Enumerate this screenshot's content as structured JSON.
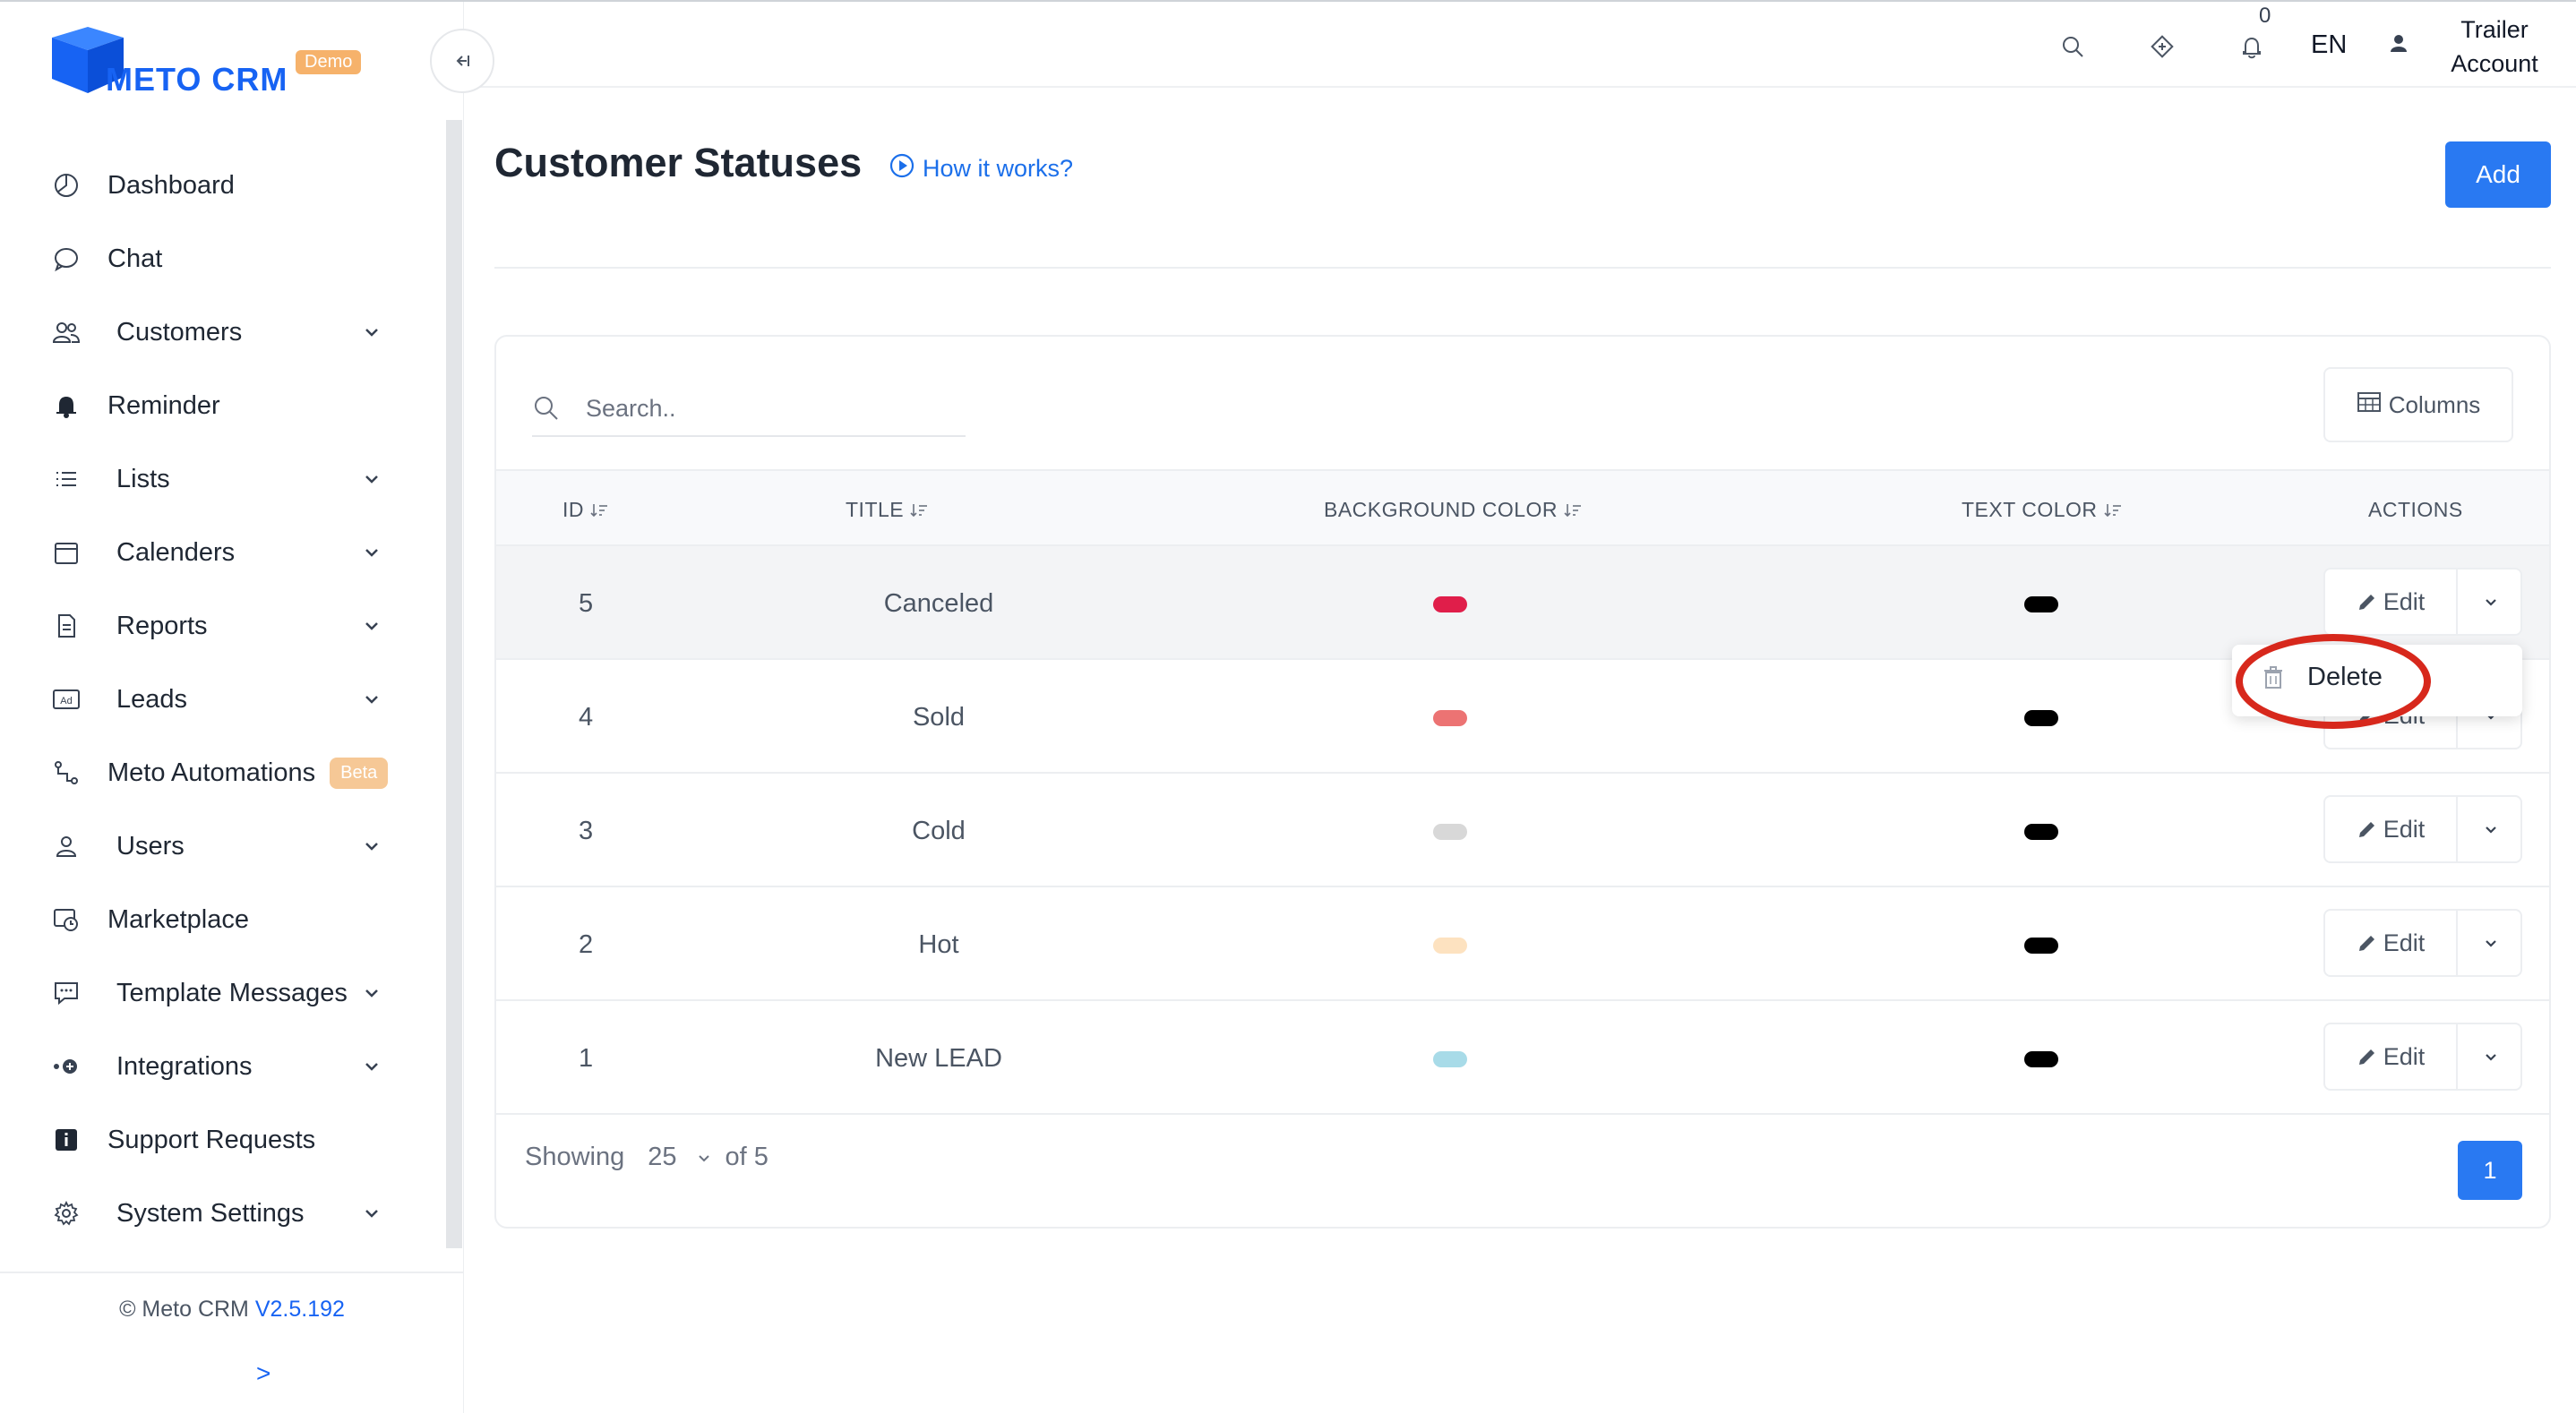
{
  "app": {
    "brand_name": "METO CRM",
    "brand_badge": "Demo"
  },
  "sidebar": {
    "items": [
      {
        "label": "Dashboard",
        "icon": "dashboard-icon",
        "has_chevron": false
      },
      {
        "label": "Chat",
        "icon": "chat-icon",
        "has_chevron": false
      },
      {
        "label": "Customers",
        "icon": "customers-icon",
        "has_chevron": true
      },
      {
        "label": "Reminder",
        "icon": "bell-icon",
        "has_chevron": false
      },
      {
        "label": "Lists",
        "icon": "list-icon",
        "has_chevron": true
      },
      {
        "label": "Calenders",
        "icon": "calendar-icon",
        "has_chevron": true
      },
      {
        "label": "Reports",
        "icon": "report-icon",
        "has_chevron": true
      },
      {
        "label": "Leads",
        "icon": "ad-icon",
        "has_chevron": true
      },
      {
        "label": "Meto Automations",
        "icon": "automation-icon",
        "has_chevron": false,
        "badge": "Beta"
      },
      {
        "label": "Users",
        "icon": "user-icon",
        "has_chevron": true
      },
      {
        "label": "Marketplace",
        "icon": "marketplace-icon",
        "has_chevron": false
      },
      {
        "label": "Template Messages",
        "icon": "template-message-icon",
        "has_chevron": true
      },
      {
        "label": "Integrations",
        "icon": "integrations-icon",
        "has_chevron": true
      },
      {
        "label": "Support Requests",
        "icon": "info-icon",
        "has_chevron": false
      },
      {
        "label": "System Settings",
        "icon": "gear-icon",
        "has_chevron": true
      }
    ],
    "footer": {
      "copyright": "© Meto CRM",
      "version": "V2.5.192",
      "expand": ">"
    }
  },
  "topbar": {
    "notification_count": "0",
    "language": "EN",
    "account_line1": "Trailer",
    "account_line2": "Account"
  },
  "page": {
    "title": "Customer Statuses",
    "how_it_works": "How it works?",
    "add_label": "Add"
  },
  "table": {
    "search_placeholder": "Search..",
    "columns_label": "Columns",
    "headers": {
      "id": "ID",
      "title": "TITLE",
      "background_color": "BACKGROUND COLOR",
      "text_color": "TEXT COLOR",
      "actions": "ACTIONS"
    },
    "rows": [
      {
        "id": "5",
        "title": "Canceled",
        "bg_color": "#e01e4a",
        "text_color": "#000000"
      },
      {
        "id": "4",
        "title": "Sold",
        "bg_color": "#ec7373",
        "text_color": "#000000"
      },
      {
        "id": "3",
        "title": "Cold",
        "bg_color": "#d8d8d8",
        "text_color": "#000000"
      },
      {
        "id": "2",
        "title": "Hot",
        "bg_color": "#fde2c0",
        "text_color": "#000000"
      },
      {
        "id": "1",
        "title": "New LEAD",
        "bg_color": "#a8dbe8",
        "text_color": "#000000"
      }
    ],
    "edit_label": "Edit",
    "dropdown": {
      "delete_label": "Delete"
    },
    "footer": {
      "showing": "Showing",
      "page_size": "25",
      "of_total": "of 5",
      "current_page": "1"
    }
  },
  "colors": {
    "accent": "#2979f2",
    "brand": "#1763f3",
    "annotation": "#d7281c"
  }
}
